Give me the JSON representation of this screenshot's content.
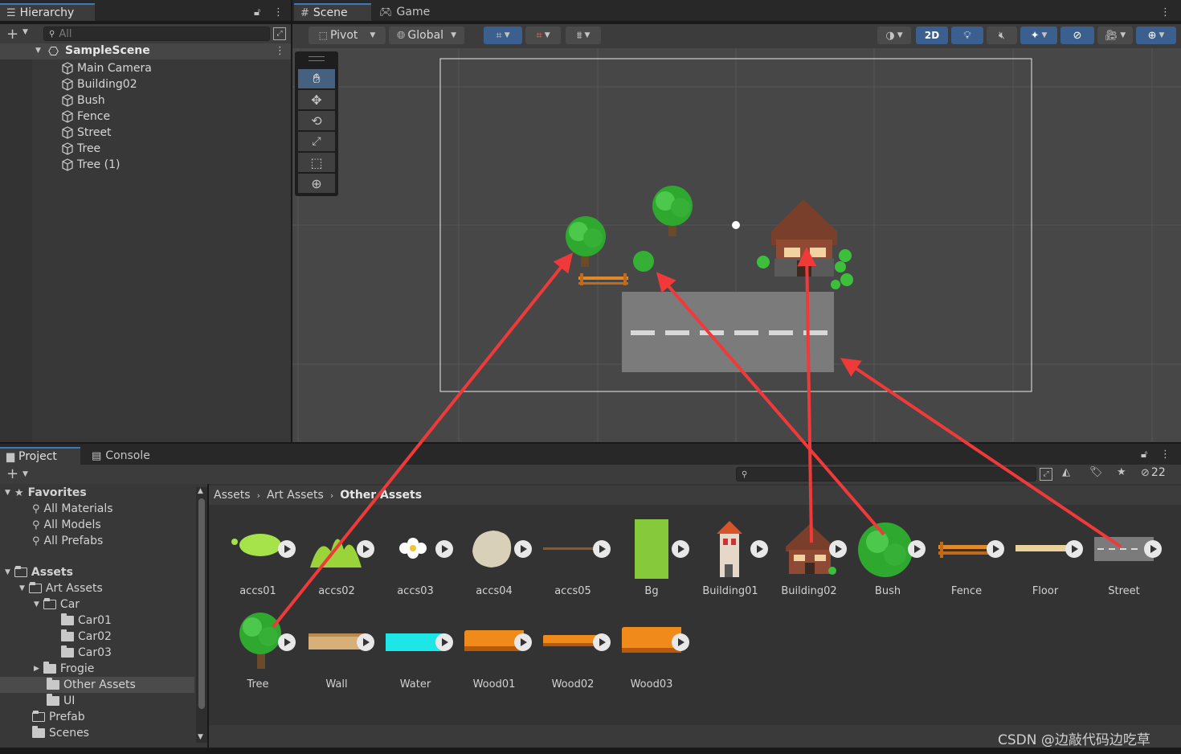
{
  "hierarchy": {
    "tab_label": "Hierarchy",
    "search_placeholder": "All",
    "scene_name": "SampleScene",
    "items": [
      "Main Camera",
      "Building02",
      "Bush",
      "Fence",
      "Street",
      "Tree",
      "Tree (1)"
    ]
  },
  "scene_view": {
    "tabs": [
      "Scene",
      "Game"
    ],
    "pivot_label": "Pivot",
    "global_label": "Global",
    "mode_2d_label": "2D"
  },
  "project": {
    "tabs": [
      "Project",
      "Console"
    ],
    "hidden_count": "22",
    "favorites": {
      "label": "Favorites",
      "items": [
        "All Materials",
        "All Models",
        "All Prefabs"
      ]
    },
    "tree": {
      "assets": "Assets",
      "art_assets": "Art Assets",
      "car": "Car",
      "car_children": [
        "Car01",
        "Car02",
        "Car03"
      ],
      "frogie": "Frogie",
      "other_assets": "Other Assets",
      "ui": "UI",
      "prefab": "Prefab",
      "scenes": "Scenes"
    },
    "breadcrumb": [
      "Assets",
      "Art Assets",
      "Other Assets"
    ],
    "assets": [
      "accs01",
      "accs02",
      "accs03",
      "accs04",
      "accs05",
      "Bg",
      "Building01",
      "Building02",
      "Bush",
      "Fence",
      "Floor",
      "Street",
      "Tree",
      "Wall",
      "Water",
      "Wood01",
      "Wood02",
      "Wood03"
    ]
  },
  "watermark": "CSDN @边敲代码边吃草",
  "colors": {
    "accent_blue": "#3a79bb",
    "annotation_red": "#f03a3a",
    "panel_bg": "#383838",
    "scene_bg": "#474747"
  }
}
